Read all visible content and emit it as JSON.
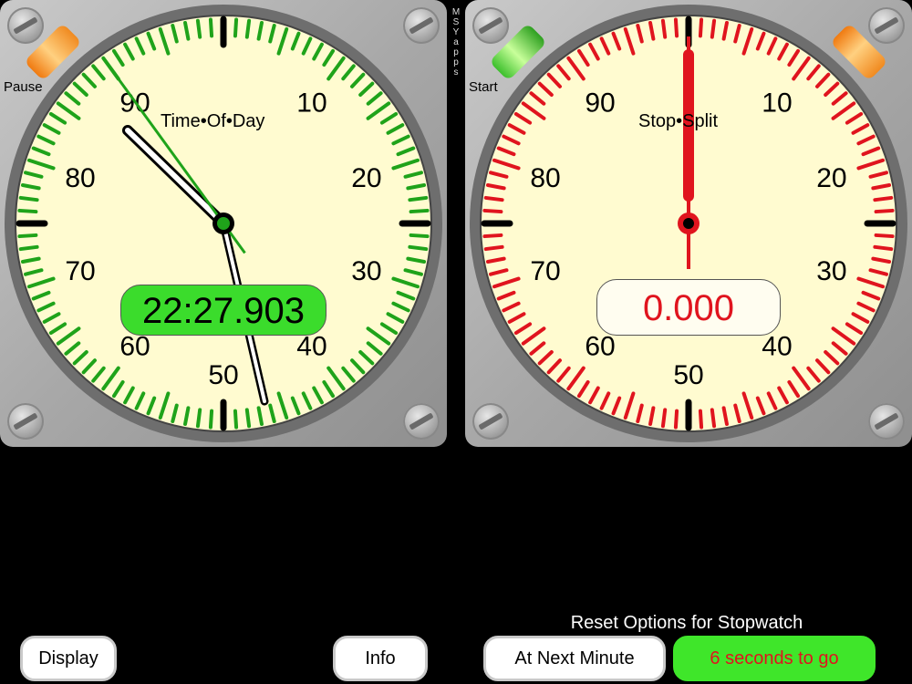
{
  "brand": {
    "text": "MSYapps"
  },
  "left_dial": {
    "title": "Time•Of•Day",
    "readout": "22:27.903",
    "knob_label": "Pause",
    "numbers": [
      "10",
      "20",
      "30",
      "40",
      "50",
      "60",
      "70",
      "80",
      "90"
    ],
    "tick_color": "#1fa31a",
    "hand_color": "#1fa31a",
    "hand_level_fraction_of_dial": 0.9
  },
  "right_dial": {
    "title": "Stop•Split",
    "readout": "0.000",
    "knob_label": "Start",
    "numbers": [
      "10",
      "20",
      "30",
      "40",
      "50",
      "60",
      "70",
      "80",
      "90"
    ],
    "tick_color": "#e0141e",
    "hand_color": "#e0141e",
    "hand_level_fraction_of_dial": 0.0
  },
  "colors": {
    "dial_face": "#fffbd0",
    "bezel": "#7a7a7a"
  },
  "buttons": {
    "display": "Display",
    "info": "Info",
    "next_minute": "At Next Minute",
    "countdown": "6 seconds to go"
  },
  "reset_caption": "Reset Options for Stopwatch"
}
